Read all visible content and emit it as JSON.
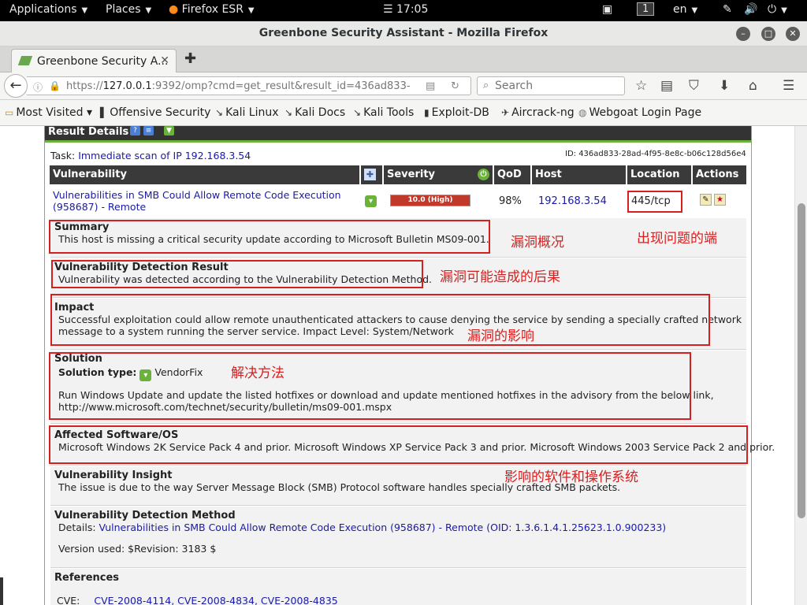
{
  "topbar": {
    "applications": "Applications",
    "places": "Places",
    "firefox": "Firefox ESR",
    "clock": "☰ 17:05",
    "workspace": "1",
    "lang": "en"
  },
  "window": {
    "title": "Greenbone Security Assistant - Mozilla Firefox"
  },
  "tab": {
    "label": "Greenbone Security A..."
  },
  "nav": {
    "url_dim": "https://",
    "url_host": "127.0.0.1",
    "url_rest": ":9392/omp?cmd=get_result&result_id=436ad833-",
    "search_placeholder": "Search"
  },
  "bookmarks": [
    "Most Visited ▾",
    "Offensive Security",
    "Kali Linux",
    "Kali Docs",
    "Kali Tools",
    "Exploit-DB",
    "Aircrack-ng",
    "Webgoat Login Page"
  ],
  "page": {
    "header": "Result Details",
    "task_label": "Task:",
    "task_link": "Immediate scan of IP 192.168.3.54",
    "id": "ID: 436ad833-28ad-4f95-8e8c-b06c128d56e4",
    "columns": [
      "Vulnerability",
      "Severity",
      "QoD",
      "Host",
      "Location",
      "Actions"
    ],
    "row": {
      "vuln_line1": "Vulnerabilities in SMB Could Allow Remote Code Execution",
      "vuln_line2": "(958687) - Remote",
      "severity": "10.0 (High)",
      "severity_value": 10.0,
      "qod": "98%",
      "host": "192.168.3.54",
      "location": "445/tcp"
    },
    "summary": {
      "title": "Summary",
      "text": "This host is missing a critical security update according to Microsoft Bulletin MS09-001."
    },
    "detection": {
      "title": "Vulnerability Detection Result",
      "text": "Vulnerability was detected according to the Vulnerability Detection Method."
    },
    "impact": {
      "title": "Impact",
      "line1": "Successful exploitation could allow remote unauthenticated attackers to cause denying the service by sending a specially crafted network",
      "line2": "message to a system running the server service. Impact Level: System/Network"
    },
    "solution": {
      "title": "Solution",
      "type_label": "Solution type:",
      "type_value": "VendorFix",
      "line1": "Run Windows Update and update the listed hotfixes or download and update mentioned hotfixes in the advisory from the below link,",
      "line2": "http://www.microsoft.com/technet/security/bulletin/ms09-001.mspx"
    },
    "affected": {
      "title": "Affected Software/OS",
      "text": "Microsoft Windows 2K Service Pack 4 and prior. Microsoft Windows XP Service Pack 3 and prior. Microsoft Windows 2003 Service Pack 2 and prior."
    },
    "insight": {
      "title": "Vulnerability Insight",
      "text": "The issue is due to the way Server Message Block (SMB) Protocol software handles specially crafted SMB packets."
    },
    "method": {
      "title": "Vulnerability Detection Method",
      "details_label": "Details:",
      "details_link": "Vulnerabilities in SMB Could Allow Remote Code Execution (958687) - Remote (OID: 1.3.6.1.4.1.25623.1.0.900233)",
      "version": "Version used: $Revision: 3183 $"
    },
    "references": {
      "title": "References",
      "cve_label": "CVE:",
      "cve_list": "CVE-2008-4114, CVE-2008-4834, CVE-2008-4835"
    }
  },
  "annotations": {
    "summary_note": "漏洞概况",
    "port_note": "出现问题的端",
    "result_note": "漏洞可能造成的后果",
    "impact_note": "漏洞的影响",
    "solution_note": "解决方法",
    "affected_note": "影响的软件和操作系统"
  },
  "colors": {
    "annotation_red": "#d62020",
    "link_blue": "#1a1aa6",
    "header_green": "#6ab23a",
    "severity_high": "#c0392b"
  }
}
